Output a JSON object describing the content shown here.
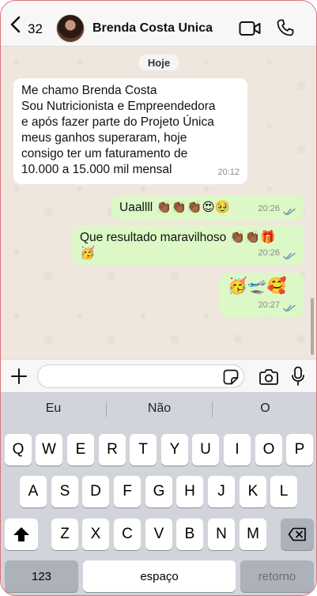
{
  "header": {
    "back_count": "32",
    "contact_name": "Brenda Costa Unica"
  },
  "chat": {
    "date_label": "Hoje",
    "messages": [
      {
        "direction": "incoming",
        "lines": [
          "Me chamo Brenda Costa",
          "Sou Nutricionista e Empreendedora",
          "e após fazer parte do Projeto Única",
          "meus ganhos superaram, hoje",
          "consigo ter um faturamento de",
          "10.000 a 15.000 mil mensal"
        ],
        "time": "20:12"
      },
      {
        "direction": "outgoing",
        "text": "Uaallll 👏🏾👏🏾👏🏾😍🥹",
        "time": "20:26",
        "read": true
      },
      {
        "direction": "outgoing",
        "line1": "Que resultado maravilhoso 👏🏾👏🏾🎁",
        "line2": "🥳",
        "time": "20:26",
        "read": true
      },
      {
        "direction": "outgoing",
        "text": "🥳🛫🥰",
        "time": "20:27",
        "read": true
      }
    ]
  },
  "input": {
    "placeholder": ""
  },
  "keyboard": {
    "suggestions": [
      "Eu",
      "Não",
      "O"
    ],
    "row1": [
      "Q",
      "W",
      "E",
      "R",
      "T",
      "Y",
      "U",
      "I",
      "O",
      "P"
    ],
    "row2": [
      "A",
      "S",
      "D",
      "F",
      "G",
      "H",
      "J",
      "K",
      "L"
    ],
    "row3": [
      "Z",
      "X",
      "C",
      "V",
      "B",
      "N",
      "M"
    ],
    "numbers_key": "123",
    "space_key": "espaço",
    "return_key": "retorno"
  },
  "icons": {
    "back": "chevron-left-icon",
    "video": "video-camera-icon",
    "phone": "phone-icon",
    "plus": "plus-icon",
    "sticker": "sticker-icon",
    "camera": "camera-icon",
    "mic": "microphone-icon",
    "shift": "shift-arrow-icon",
    "delete": "backspace-icon"
  },
  "colors": {
    "outgoing_bubble": "#dcf8c6",
    "incoming_bubble": "#ffffff",
    "chat_background": "#efe7dd",
    "read_ticks": "#6a8fb5"
  }
}
